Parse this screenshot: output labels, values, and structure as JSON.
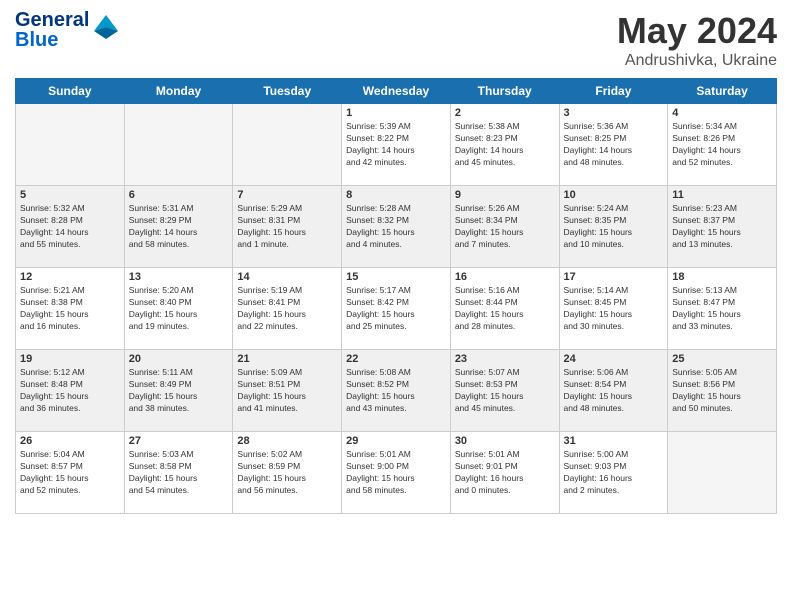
{
  "header": {
    "logo_line1": "General",
    "logo_line2": "Blue",
    "month": "May 2024",
    "location": "Andrushivka, Ukraine"
  },
  "weekdays": [
    "Sunday",
    "Monday",
    "Tuesday",
    "Wednesday",
    "Thursday",
    "Friday",
    "Saturday"
  ],
  "weeks": [
    [
      {
        "day": "",
        "info": ""
      },
      {
        "day": "",
        "info": ""
      },
      {
        "day": "",
        "info": ""
      },
      {
        "day": "1",
        "info": "Sunrise: 5:39 AM\nSunset: 8:22 PM\nDaylight: 14 hours\nand 42 minutes."
      },
      {
        "day": "2",
        "info": "Sunrise: 5:38 AM\nSunset: 8:23 PM\nDaylight: 14 hours\nand 45 minutes."
      },
      {
        "day": "3",
        "info": "Sunrise: 5:36 AM\nSunset: 8:25 PM\nDaylight: 14 hours\nand 48 minutes."
      },
      {
        "day": "4",
        "info": "Sunrise: 5:34 AM\nSunset: 8:26 PM\nDaylight: 14 hours\nand 52 minutes."
      }
    ],
    [
      {
        "day": "5",
        "info": "Sunrise: 5:32 AM\nSunset: 8:28 PM\nDaylight: 14 hours\nand 55 minutes."
      },
      {
        "day": "6",
        "info": "Sunrise: 5:31 AM\nSunset: 8:29 PM\nDaylight: 14 hours\nand 58 minutes."
      },
      {
        "day": "7",
        "info": "Sunrise: 5:29 AM\nSunset: 8:31 PM\nDaylight: 15 hours\nand 1 minute."
      },
      {
        "day": "8",
        "info": "Sunrise: 5:28 AM\nSunset: 8:32 PM\nDaylight: 15 hours\nand 4 minutes."
      },
      {
        "day": "9",
        "info": "Sunrise: 5:26 AM\nSunset: 8:34 PM\nDaylight: 15 hours\nand 7 minutes."
      },
      {
        "day": "10",
        "info": "Sunrise: 5:24 AM\nSunset: 8:35 PM\nDaylight: 15 hours\nand 10 minutes."
      },
      {
        "day": "11",
        "info": "Sunrise: 5:23 AM\nSunset: 8:37 PM\nDaylight: 15 hours\nand 13 minutes."
      }
    ],
    [
      {
        "day": "12",
        "info": "Sunrise: 5:21 AM\nSunset: 8:38 PM\nDaylight: 15 hours\nand 16 minutes."
      },
      {
        "day": "13",
        "info": "Sunrise: 5:20 AM\nSunset: 8:40 PM\nDaylight: 15 hours\nand 19 minutes."
      },
      {
        "day": "14",
        "info": "Sunrise: 5:19 AM\nSunset: 8:41 PM\nDaylight: 15 hours\nand 22 minutes."
      },
      {
        "day": "15",
        "info": "Sunrise: 5:17 AM\nSunset: 8:42 PM\nDaylight: 15 hours\nand 25 minutes."
      },
      {
        "day": "16",
        "info": "Sunrise: 5:16 AM\nSunset: 8:44 PM\nDaylight: 15 hours\nand 28 minutes."
      },
      {
        "day": "17",
        "info": "Sunrise: 5:14 AM\nSunset: 8:45 PM\nDaylight: 15 hours\nand 30 minutes."
      },
      {
        "day": "18",
        "info": "Sunrise: 5:13 AM\nSunset: 8:47 PM\nDaylight: 15 hours\nand 33 minutes."
      }
    ],
    [
      {
        "day": "19",
        "info": "Sunrise: 5:12 AM\nSunset: 8:48 PM\nDaylight: 15 hours\nand 36 minutes."
      },
      {
        "day": "20",
        "info": "Sunrise: 5:11 AM\nSunset: 8:49 PM\nDaylight: 15 hours\nand 38 minutes."
      },
      {
        "day": "21",
        "info": "Sunrise: 5:09 AM\nSunset: 8:51 PM\nDaylight: 15 hours\nand 41 minutes."
      },
      {
        "day": "22",
        "info": "Sunrise: 5:08 AM\nSunset: 8:52 PM\nDaylight: 15 hours\nand 43 minutes."
      },
      {
        "day": "23",
        "info": "Sunrise: 5:07 AM\nSunset: 8:53 PM\nDaylight: 15 hours\nand 45 minutes."
      },
      {
        "day": "24",
        "info": "Sunrise: 5:06 AM\nSunset: 8:54 PM\nDaylight: 15 hours\nand 48 minutes."
      },
      {
        "day": "25",
        "info": "Sunrise: 5:05 AM\nSunset: 8:56 PM\nDaylight: 15 hours\nand 50 minutes."
      }
    ],
    [
      {
        "day": "26",
        "info": "Sunrise: 5:04 AM\nSunset: 8:57 PM\nDaylight: 15 hours\nand 52 minutes."
      },
      {
        "day": "27",
        "info": "Sunrise: 5:03 AM\nSunset: 8:58 PM\nDaylight: 15 hours\nand 54 minutes."
      },
      {
        "day": "28",
        "info": "Sunrise: 5:02 AM\nSunset: 8:59 PM\nDaylight: 15 hours\nand 56 minutes."
      },
      {
        "day": "29",
        "info": "Sunrise: 5:01 AM\nSunset: 9:00 PM\nDaylight: 15 hours\nand 58 minutes."
      },
      {
        "day": "30",
        "info": "Sunrise: 5:01 AM\nSunset: 9:01 PM\nDaylight: 16 hours\nand 0 minutes."
      },
      {
        "day": "31",
        "info": "Sunrise: 5:00 AM\nSunset: 9:03 PM\nDaylight: 16 hours\nand 2 minutes."
      },
      {
        "day": "",
        "info": ""
      }
    ]
  ]
}
